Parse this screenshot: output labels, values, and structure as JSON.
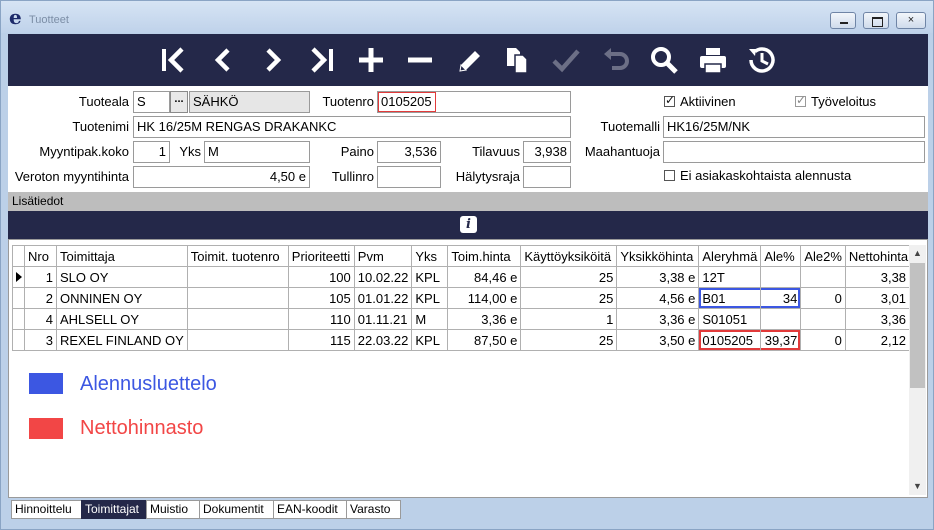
{
  "window": {
    "title": "Tuotteet",
    "logo": "e",
    "controls": {
      "minimize": "minimize-icon",
      "maximize": "maximize-icon",
      "close": "×"
    }
  },
  "toolbar": {
    "buttons": [
      {
        "name": "first-record",
        "icon": "first-icon"
      },
      {
        "name": "previous-record",
        "icon": "chevron-left-icon"
      },
      {
        "name": "next-record",
        "icon": "chevron-right-icon"
      },
      {
        "name": "last-record",
        "icon": "last-icon"
      },
      {
        "name": "add",
        "icon": "plus-icon"
      },
      {
        "name": "delete",
        "icon": "minus-icon"
      },
      {
        "name": "edit",
        "icon": "pencil-icon"
      },
      {
        "name": "copy",
        "icon": "copy-icon"
      },
      {
        "name": "save",
        "icon": "checkmark-icon",
        "disabled": true
      },
      {
        "name": "undo",
        "icon": "undo-icon",
        "disabled": true
      },
      {
        "name": "search",
        "icon": "search-icon"
      },
      {
        "name": "print",
        "icon": "printer-icon"
      },
      {
        "name": "history",
        "icon": "history-icon"
      }
    ]
  },
  "form": {
    "tuoteala": {
      "label": "Tuoteala",
      "code": "S",
      "button": "...",
      "name": "SÄHKÖ"
    },
    "tuotenro": {
      "label": "Tuotenro",
      "value": "0105205"
    },
    "tuotenimi": {
      "label": "Tuotenimi",
      "value": "HK 16/25M RENGAS DRAKANKC"
    },
    "tuotemalli": {
      "label": "Tuotemalli",
      "value": "HK16/25M/NK"
    },
    "myyntipak": {
      "label": "Myyntipak.koko",
      "value": "1"
    },
    "yks": {
      "label": "Yks",
      "value": "M"
    },
    "paino": {
      "label": "Paino",
      "value": "3,536"
    },
    "tilavuus": {
      "label": "Tilavuus",
      "value": "3,938"
    },
    "maahantuoja": {
      "label": "Maahantuoja",
      "value": ""
    },
    "veroton": {
      "label": "Veroton myyntihinta",
      "value": "4,50 e"
    },
    "tullinro": {
      "label": "Tullinro",
      "value": ""
    },
    "halytysraja": {
      "label": "Hälytysraja",
      "value": ""
    },
    "aktiivinen": {
      "label": "Aktiivinen",
      "checked": true
    },
    "tyoveloitus": {
      "label": "Työveloitus",
      "checked": true,
      "disabled": true
    },
    "ei_alennus": {
      "label": "Ei asiakaskohtaista alennusta",
      "checked": false
    }
  },
  "lisatiedot": {
    "label": "Lisätiedot",
    "info_icon": "i"
  },
  "grid": {
    "columns": [
      "Nro",
      "Toimittaja",
      "Toimit. tuotenro",
      "Prioriteetti",
      "Pvm",
      "Yks",
      "Toim.hinta",
      "Käyttöyksiköitä",
      "Yksikköhinta",
      "Aleryhmä",
      "Ale%",
      "Ale2%",
      "Nettohinta"
    ],
    "rows": [
      {
        "nro": "1",
        "toimittaja": "SLO OY",
        "toimit_tuotenro": "",
        "prioriteetti": "100",
        "pvm": "10.02.22",
        "yks": "KPL",
        "toim_hinta": "84,46 e",
        "kayttoyksikoita": "25",
        "yksikkohinta": "3,38 e",
        "aleryhma": "12T",
        "ale": "",
        "ale2": "",
        "nettohinta": "3,38 e",
        "current": true
      },
      {
        "nro": "2",
        "toimittaja": "ONNINEN OY",
        "toimit_tuotenro": "",
        "prioriteetti": "105",
        "pvm": "01.01.22",
        "yks": "KPL",
        "toim_hinta": "114,00 e",
        "kayttoyksikoita": "25",
        "yksikkohinta": "4,56 e",
        "aleryhma": "B01",
        "ale": "34",
        "ale2": "0",
        "nettohinta": "3,01 e",
        "highlight": "blue"
      },
      {
        "nro": "4",
        "toimittaja": "AHLSELL OY",
        "toimit_tuotenro": "",
        "prioriteetti": "110",
        "pvm": "01.11.21",
        "yks": "M",
        "toim_hinta": "3,36 e",
        "kayttoyksikoita": "1",
        "yksikkohinta": "3,36 e",
        "aleryhma": "S01051",
        "ale": "",
        "ale2": "",
        "nettohinta": "3,36 e"
      },
      {
        "nro": "3",
        "toimittaja": "REXEL FINLAND OY",
        "toimit_tuotenro": "",
        "prioriteetti": "115",
        "pvm": "22.03.22",
        "yks": "KPL",
        "toim_hinta": "87,50 e",
        "kayttoyksikoita": "25",
        "yksikkohinta": "3,50 e",
        "aleryhma": "0105205",
        "ale": "39,37",
        "ale2": "0",
        "nettohinta": "2,12 e",
        "highlight": "red"
      }
    ]
  },
  "legend": [
    {
      "label": "Alennusluettelo",
      "color": "#3c57e2"
    },
    {
      "label": "Nettohinnasto",
      "color": "#f24646"
    }
  ],
  "tabs": [
    {
      "label": "Hinnoittelu",
      "active": false
    },
    {
      "label": "Toimittajat",
      "active": true
    },
    {
      "label": "Muistio",
      "active": false
    },
    {
      "label": "Dokumentit",
      "active": false
    },
    {
      "label": "EAN-koodit",
      "active": false
    },
    {
      "label": "Varasto",
      "active": false
    }
  ],
  "colors": {
    "toolbar_bg": "#242849",
    "highlight_blue": "#3c57e2",
    "highlight_red": "#e23a3a"
  }
}
